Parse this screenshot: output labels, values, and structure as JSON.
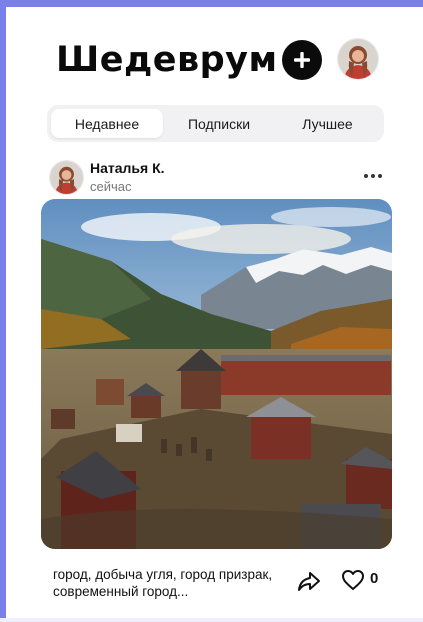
{
  "app": {
    "title": "Шедеврум"
  },
  "header": {
    "add_icon": "plus-icon",
    "avatar": "user-avatar"
  },
  "tabs": [
    {
      "label": "Недавнее",
      "active": true
    },
    {
      "label": "Подписки",
      "active": false
    },
    {
      "label": "Лучшее",
      "active": false
    }
  ],
  "post": {
    "author": "Наталья К.",
    "time": "сейчас",
    "more_icon": "more-dots-icon",
    "image_subject": "mountain-town-artwork",
    "caption": "город, добыча угля, город призрак, современный город...",
    "share_icon": "share-arrow-icon",
    "like_icon": "heart-icon",
    "likes": "0"
  },
  "colors": {
    "accent_frame": "#7b7fe8",
    "tab_bg": "#f1f1f3",
    "button_dark": "#0b0b0b"
  }
}
